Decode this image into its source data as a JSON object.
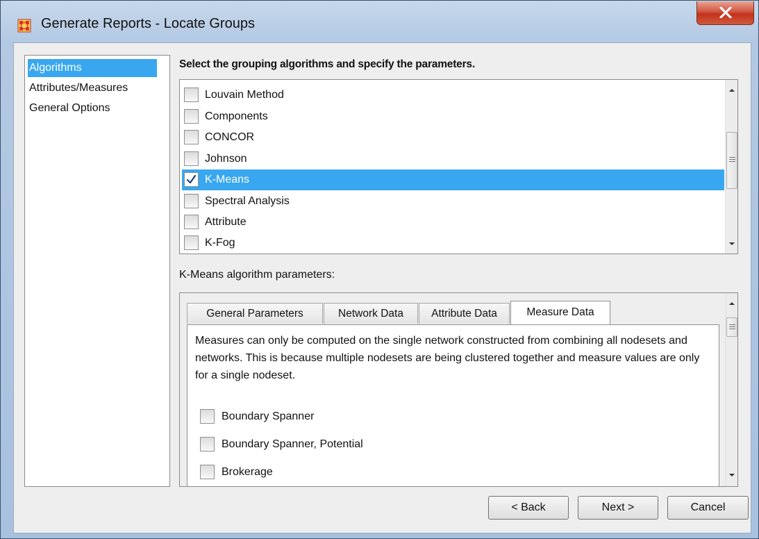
{
  "window": {
    "title": "Generate Reports - Locate Groups",
    "close_icon": "close-x-icon",
    "app_icon": "network-grid-icon",
    "accent_color": "#39a7ef"
  },
  "sidebar": {
    "items": [
      {
        "label": "Algorithms",
        "selected": true
      },
      {
        "label": "Attributes/Measures",
        "selected": false
      },
      {
        "label": "General Options",
        "selected": false
      }
    ]
  },
  "algorithms": {
    "heading": "Select the grouping algorithms and specify the parameters.",
    "items": [
      {
        "label": "Louvain Method",
        "checked": false
      },
      {
        "label": "Components",
        "checked": false
      },
      {
        "label": "CONCOR",
        "checked": false
      },
      {
        "label": "Johnson",
        "checked": false
      },
      {
        "label": "K-Means",
        "checked": true
      },
      {
        "label": "Spectral Analysis",
        "checked": false
      },
      {
        "label": "Attribute",
        "checked": false
      },
      {
        "label": "K-Fog",
        "checked": false
      }
    ]
  },
  "parameters": {
    "label": "K-Means algorithm parameters:",
    "tabs": [
      {
        "label": "General Parameters",
        "active": false
      },
      {
        "label": "Network Data",
        "active": false
      },
      {
        "label": "Attribute Data",
        "active": false
      },
      {
        "label": "Measure Data",
        "active": true
      }
    ],
    "description": "Measures can only be computed on the single network constructed from combining all nodesets and networks. This is because multiple nodesets are being clustered together and measure values are only for a single nodeset.",
    "measures": [
      {
        "label": "Boundary Spanner",
        "checked": false
      },
      {
        "label": "Boundary Spanner, Potential",
        "checked": false
      },
      {
        "label": "Brokerage",
        "checked": false
      }
    ]
  },
  "footer": {
    "back_label": "< Back",
    "next_label": "Next >",
    "cancel_label": "Cancel"
  }
}
